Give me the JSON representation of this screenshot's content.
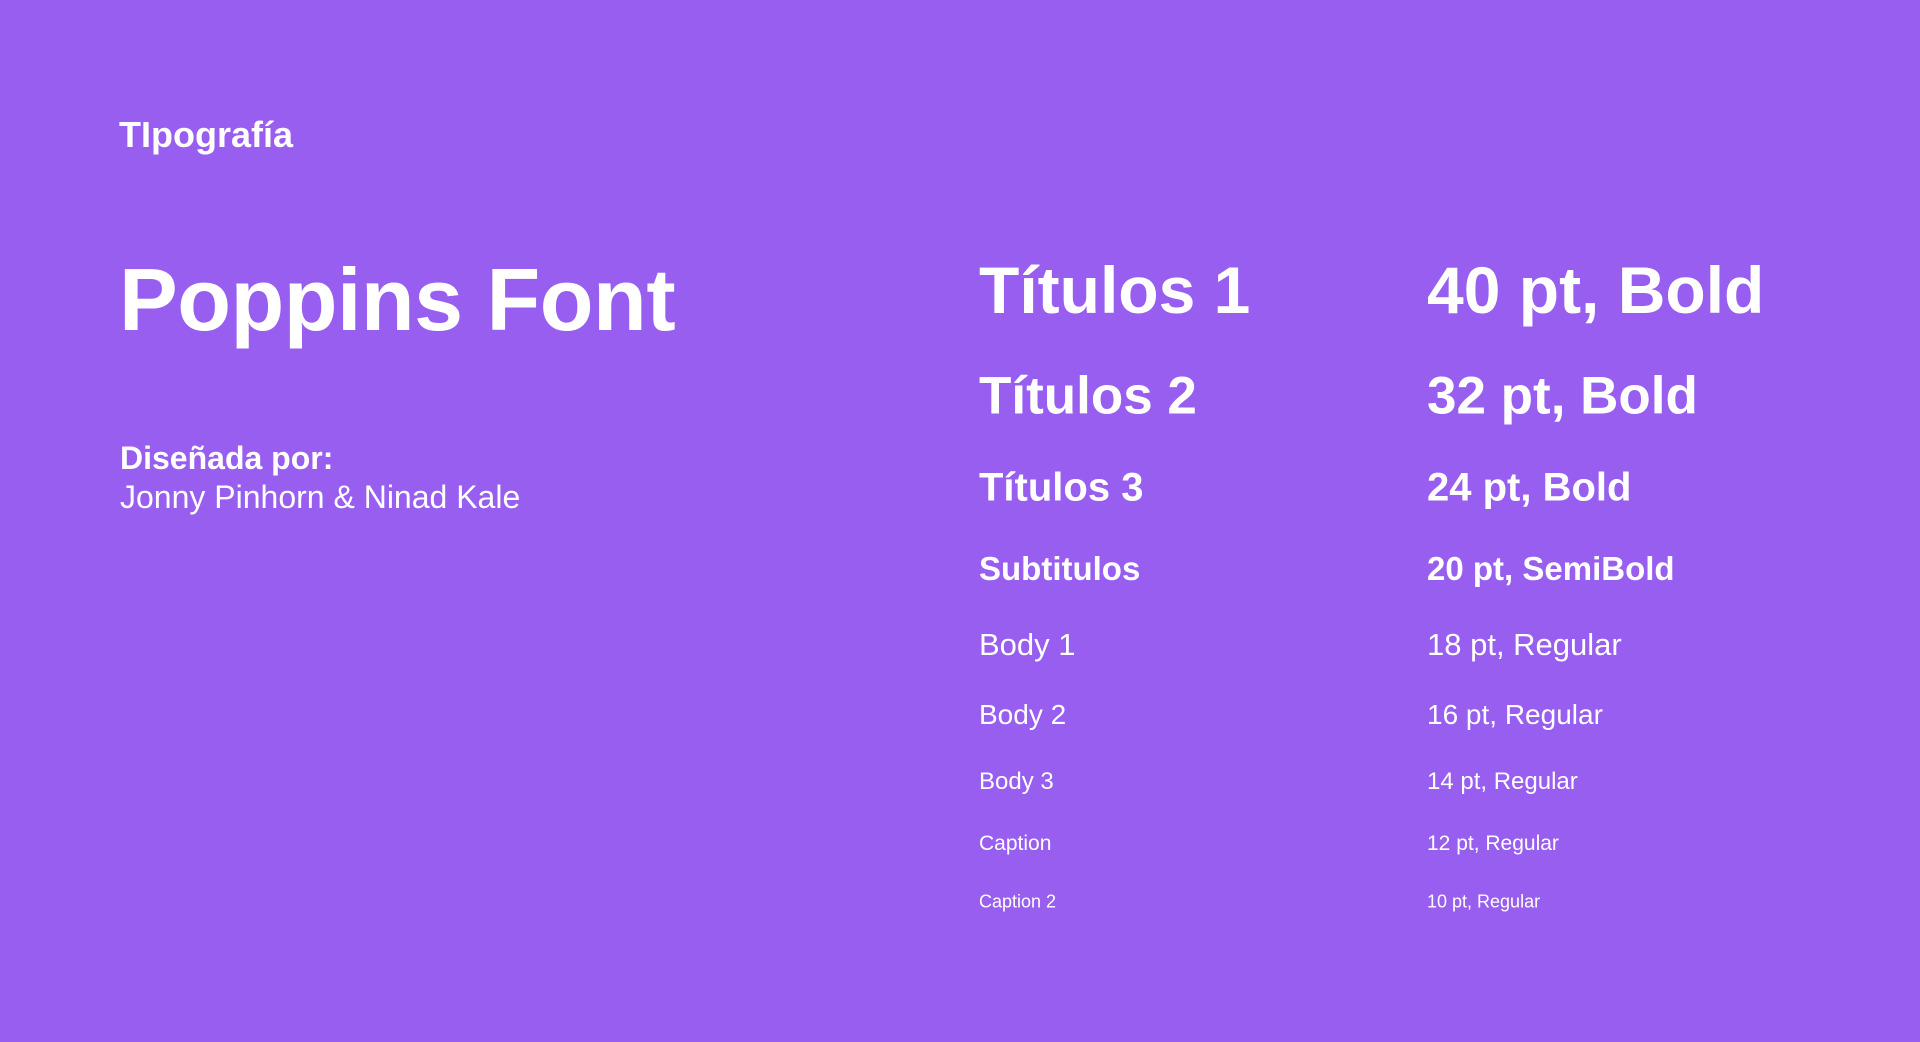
{
  "header": {
    "title": "TIpografía"
  },
  "font": {
    "name": "Poppins Font",
    "designed_by_label": "Diseñada por:",
    "designers": "Jonny Pinhorn & Ninad Kale"
  },
  "type_scale": [
    {
      "name": "Títulos 1",
      "spec": "40 pt, Bold"
    },
    {
      "name": "Títulos 2",
      "spec": "32 pt, Bold"
    },
    {
      "name": "Títulos 3",
      "spec": "24 pt, Bold"
    },
    {
      "name": "Subtitulos",
      "spec": "20 pt, SemiBold"
    },
    {
      "name": "Body 1",
      "spec": "18 pt, Regular"
    },
    {
      "name": "Body 2",
      "spec": "16 pt, Regular"
    },
    {
      "name": "Body 3",
      "spec": "14 pt, Regular"
    },
    {
      "name": "Caption",
      "spec": "12 pt, Regular"
    },
    {
      "name": "Caption 2",
      "spec": "10 pt, Regular"
    }
  ],
  "colors": {
    "background": "#975ef0",
    "text": "#ffffff"
  }
}
